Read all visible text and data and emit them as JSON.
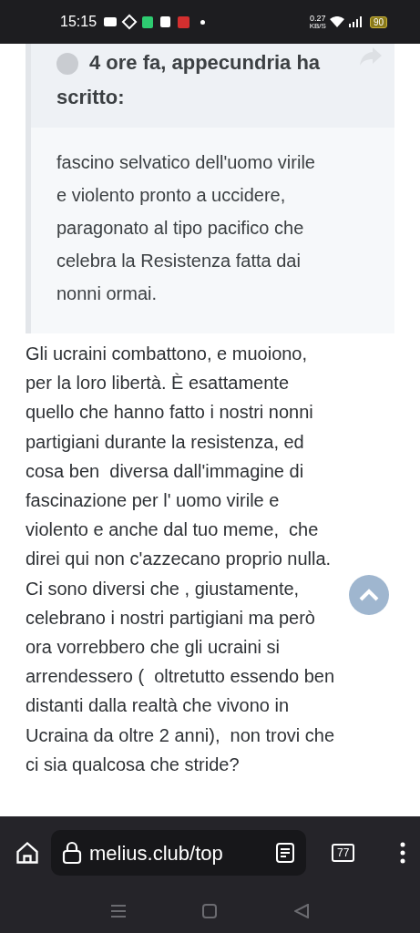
{
  "status_bar": {
    "time": "15:15",
    "speed": "0.27",
    "speed_unit": "KB/S",
    "battery": "90"
  },
  "quote": {
    "header": "4 ore fa, appecundria ha scritto:",
    "lines": [
      "fascino selvatico dell'uomo virile",
      "e violento pronto a uccidere,",
      "paragonato al tipo pacifico che",
      "celebra la Resistenza fatta dai",
      "nonni ormai."
    ]
  },
  "post": {
    "lines": [
      "Gli ucraini combattono, e muoiono,",
      "per la loro libertà. È esattamente",
      "quello che hanno fatto i nostri nonni",
      "partigiani durante la resistenza, ed",
      "cosa ben  diversa dall'immagine di",
      "fascinazione per l' uomo virile e",
      "violento e anche dal tuo meme,  che",
      "direi qui non c'azzecano proprio nulla.",
      "Ci sono diversi che , giustamente,",
      "celebrano i nostri partigiani ma però",
      "ora vorrebbero che gli ucraini si",
      "arrendessero (  oltretutto essendo ben",
      "distanti dalla realtà che vivono in",
      "Ucraina da oltre 2 anni),  non trovi che",
      "ci sia qualcosa che stride?"
    ]
  },
  "browser": {
    "url": "melius.club/top",
    "tabs": "77"
  }
}
